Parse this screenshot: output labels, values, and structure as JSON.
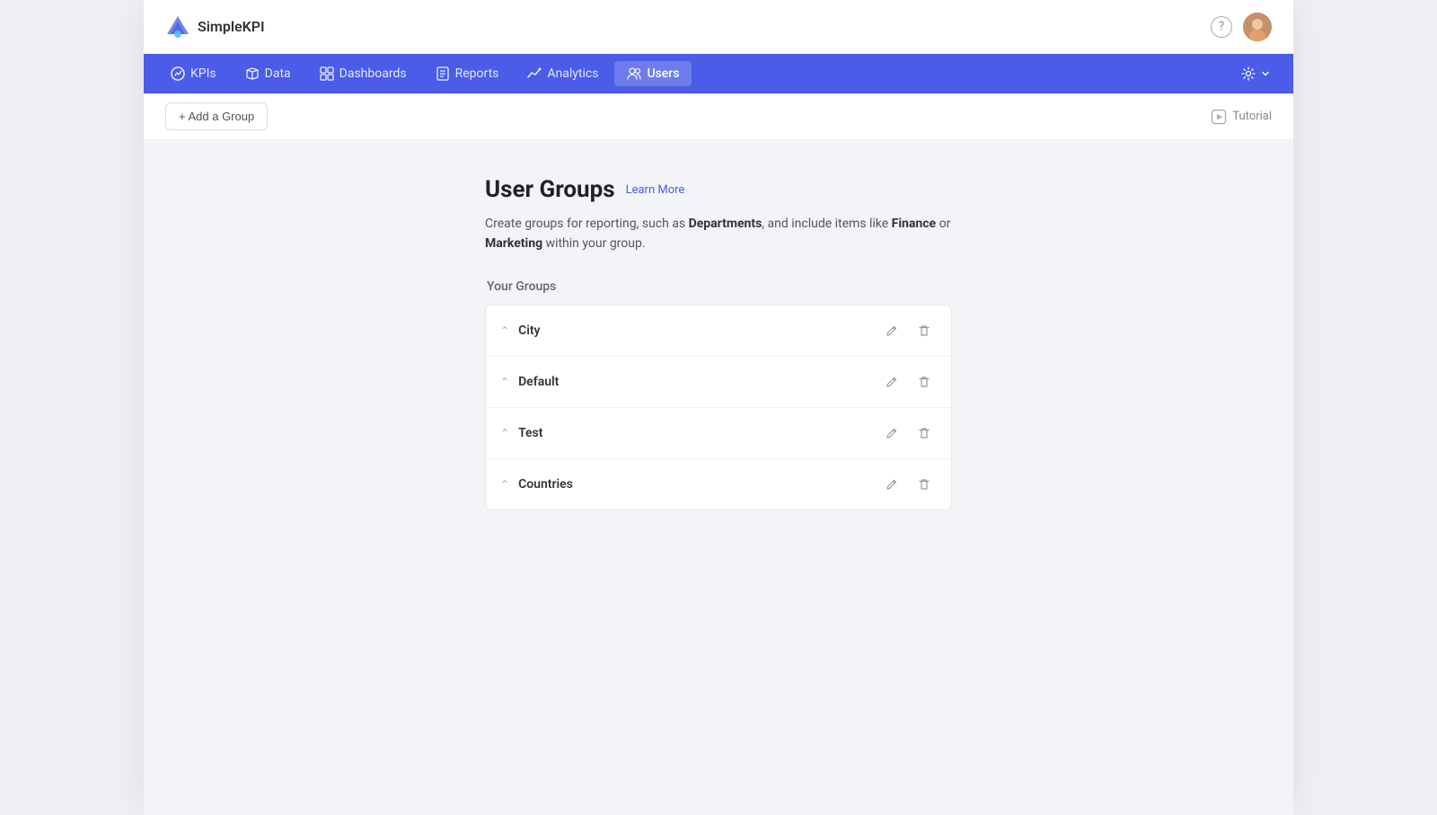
{
  "app": {
    "name": "SimpleKPI"
  },
  "header": {
    "help_title": "Help",
    "avatar_alt": "User avatar"
  },
  "nav": {
    "items": [
      {
        "id": "kpis",
        "label": "KPIs",
        "icon": "kpis-icon"
      },
      {
        "id": "data",
        "label": "Data",
        "icon": "data-icon"
      },
      {
        "id": "dashboards",
        "label": "Dashboards",
        "icon": "dashboards-icon"
      },
      {
        "id": "reports",
        "label": "Reports",
        "icon": "reports-icon"
      },
      {
        "id": "analytics",
        "label": "Analytics",
        "icon": "analytics-icon"
      },
      {
        "id": "users",
        "label": "Users",
        "icon": "users-icon",
        "active": true
      }
    ],
    "settings_label": "Settings"
  },
  "toolbar": {
    "add_group_label": "+ Add a Group",
    "tutorial_label": "Tutorial"
  },
  "page": {
    "title": "User Groups",
    "learn_more": "Learn More",
    "description_part1": "Create groups for reporting, such as ",
    "description_bold1": "Departments",
    "description_part2": ", and include items like ",
    "description_bold2": "Finance",
    "description_part3": " or ",
    "description_bold3": "Marketing",
    "description_part4": " within your group.",
    "groups_section_title": "Your Groups",
    "groups": [
      {
        "id": "city",
        "name": "City"
      },
      {
        "id": "default",
        "name": "Default"
      },
      {
        "id": "test",
        "name": "Test"
      },
      {
        "id": "countries",
        "name": "Countries"
      }
    ]
  }
}
